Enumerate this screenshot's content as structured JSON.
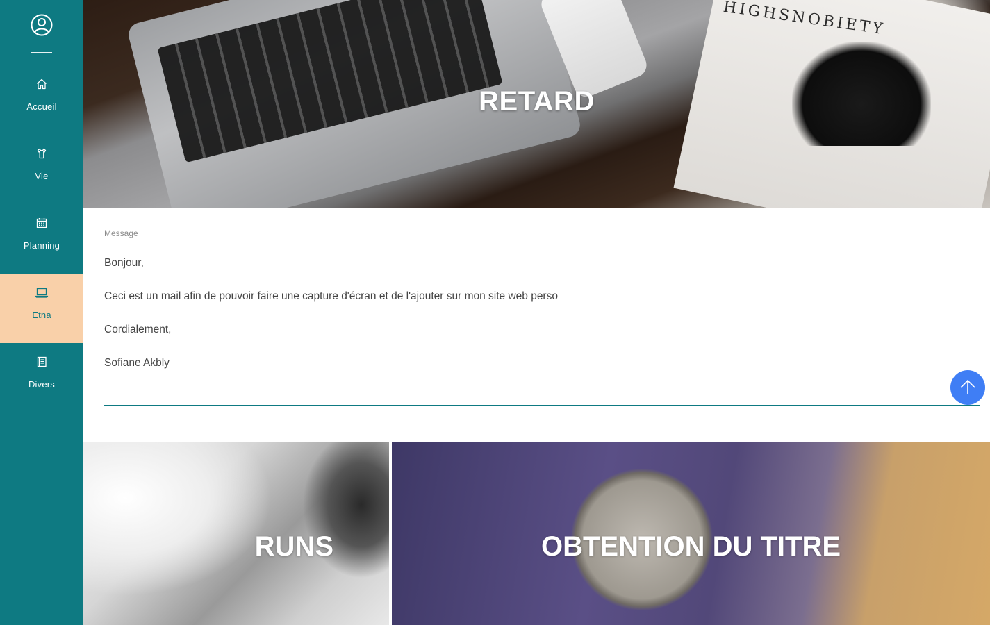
{
  "sidebar": {
    "profile_icon": "user-circle-icon",
    "items": [
      {
        "label": "Accueil",
        "icon": "home-icon"
      },
      {
        "label": "Vie",
        "icon": "shirt-icon"
      },
      {
        "label": "Planning",
        "icon": "calendar-icon"
      },
      {
        "label": "Etna",
        "icon": "laptop-icon",
        "active": true
      },
      {
        "label": "Divers",
        "icon": "notebook-icon"
      }
    ],
    "colors": {
      "background": "#0e7a82",
      "active": "#f9d0a9"
    }
  },
  "hero": {
    "title": "RETARD",
    "magazine_text": "HIGHSNOBIETY"
  },
  "message": {
    "caption": "Message",
    "lines": [
      "Bonjour,",
      "Ceci est un mail afin de pouvoir faire une capture d'écran et de l'ajouter sur mon site web perso",
      "Cordialement,",
      "Sofiane Akbly"
    ]
  },
  "back_to_top": {
    "icon": "arrow-up-icon",
    "color": "#3f7ef5"
  },
  "cards": [
    {
      "title": "RUNS"
    },
    {
      "title": "OBTENTION DU TITRE"
    }
  ]
}
